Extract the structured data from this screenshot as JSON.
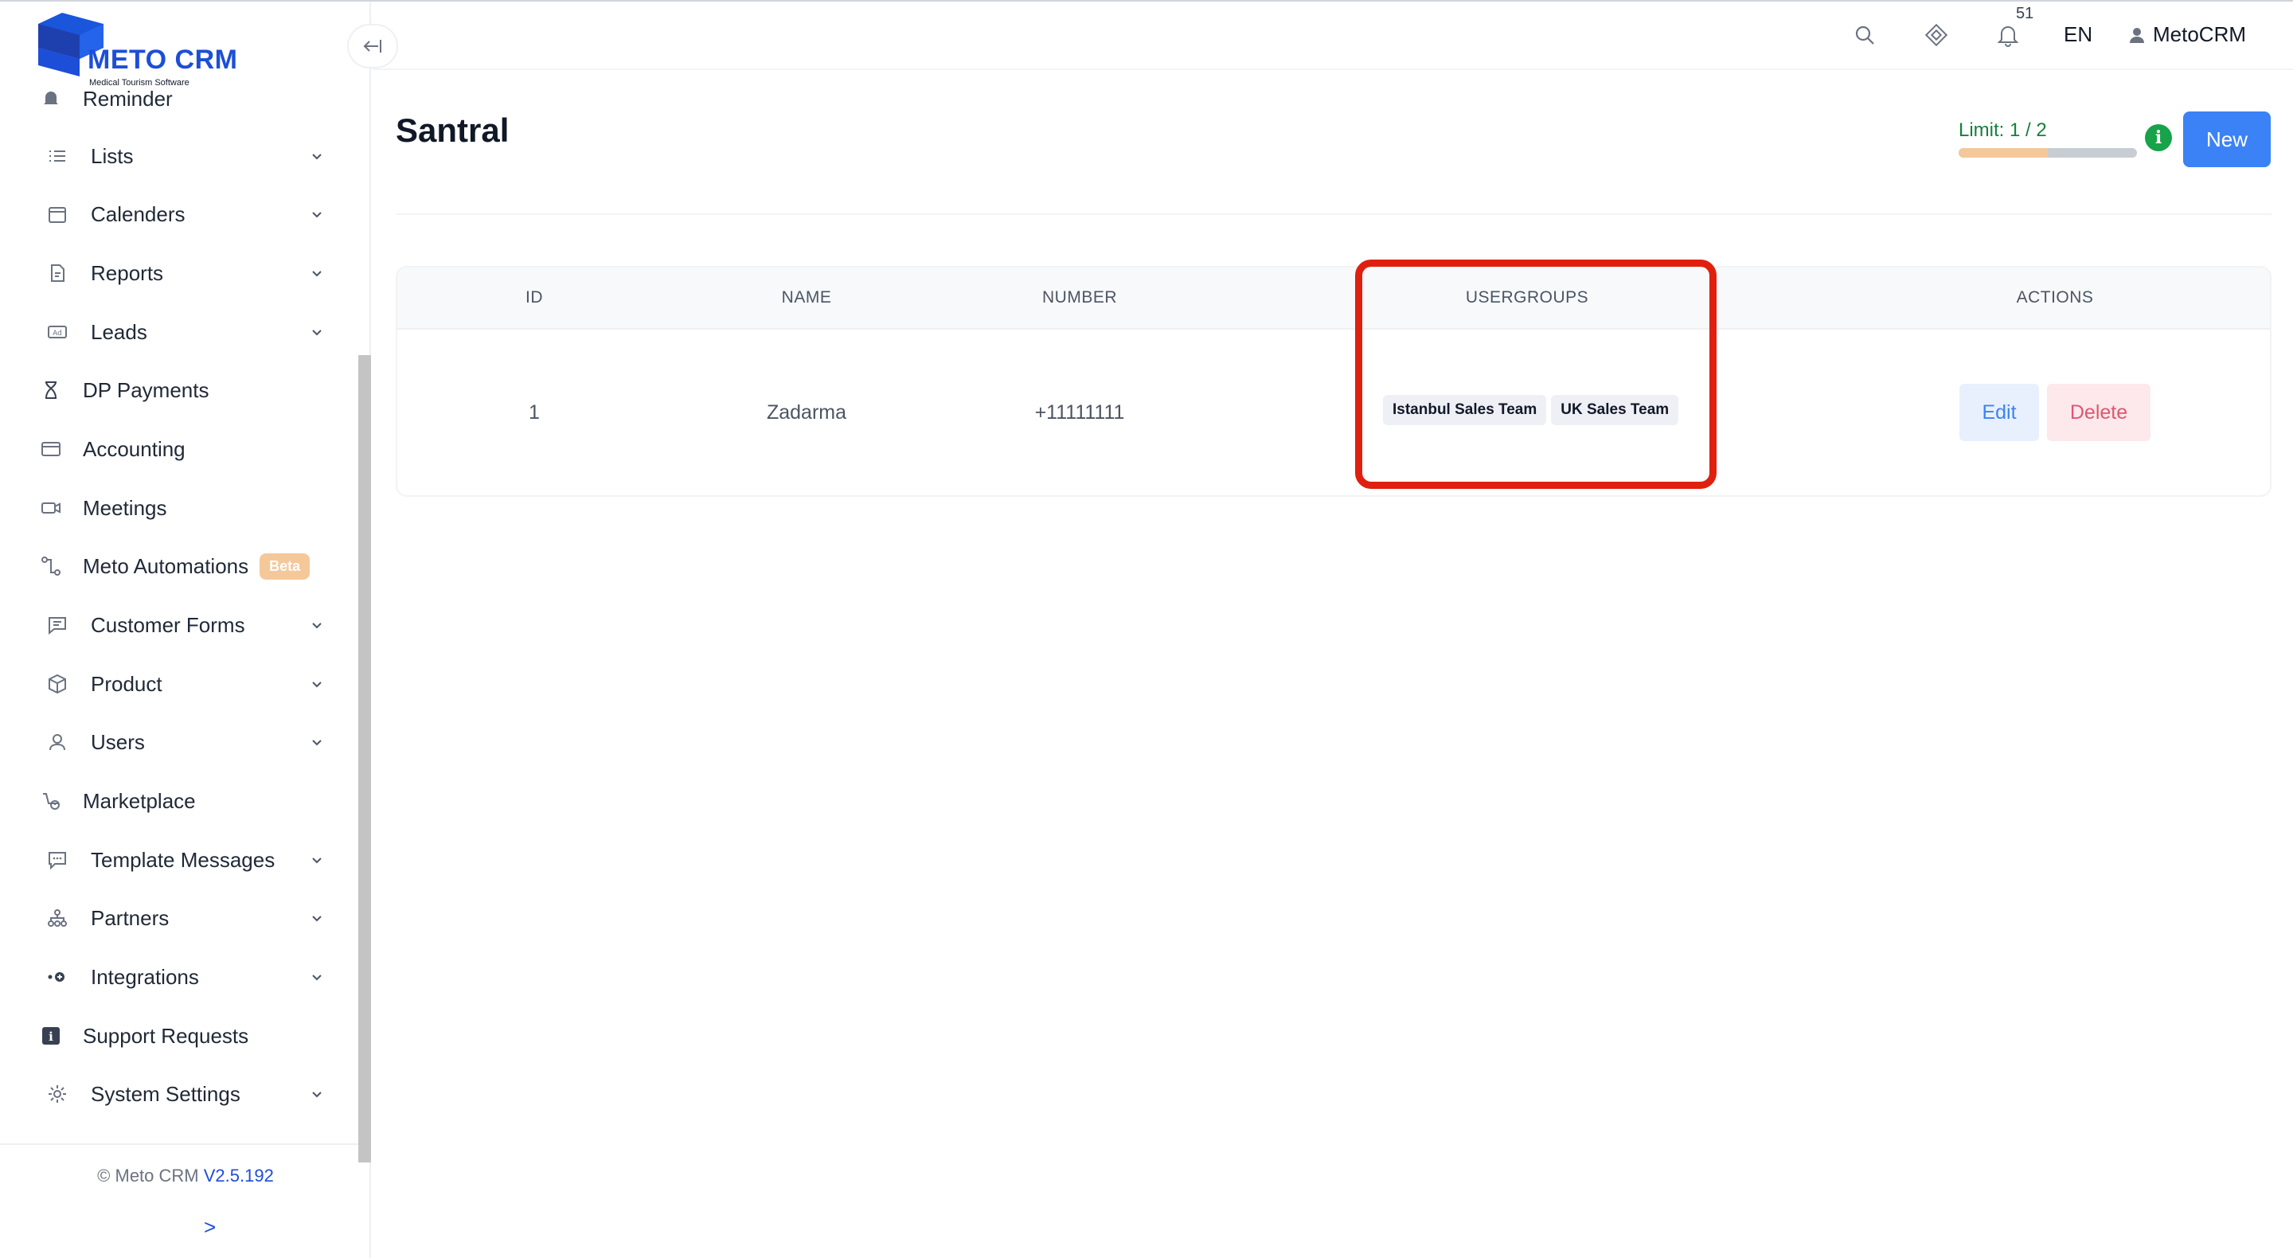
{
  "brand": {
    "name": "METO CRM",
    "tagline": "Medical Tourism Software",
    "color": "#1d4ed8"
  },
  "sidebar": {
    "items": [
      {
        "label": "Reminder",
        "icon": "bell-icon",
        "expandable": false
      },
      {
        "label": "Lists",
        "icon": "list-icon",
        "expandable": true
      },
      {
        "label": "Calenders",
        "icon": "calendar-icon",
        "expandable": true
      },
      {
        "label": "Reports",
        "icon": "report-icon",
        "expandable": true
      },
      {
        "label": "Leads",
        "icon": "ad-icon",
        "expandable": true
      },
      {
        "label": "DP Payments",
        "icon": "hourglass-icon",
        "expandable": false
      },
      {
        "label": "Accounting",
        "icon": "credit-card-icon",
        "expandable": false
      },
      {
        "label": "Meetings",
        "icon": "video-icon",
        "expandable": false
      },
      {
        "label": "Meto Automations",
        "icon": "automation-icon",
        "expandable": false,
        "badge": "Beta"
      },
      {
        "label": "Customer Forms",
        "icon": "form-icon",
        "expandable": true
      },
      {
        "label": "Product",
        "icon": "box-icon",
        "expandable": true
      },
      {
        "label": "Users",
        "icon": "user-icon",
        "expandable": true
      },
      {
        "label": "Marketplace",
        "icon": "marketplace-icon",
        "expandable": false
      },
      {
        "label": "Template Messages",
        "icon": "message-icon",
        "expandable": true
      },
      {
        "label": "Partners",
        "icon": "partners-icon",
        "expandable": true
      },
      {
        "label": "Integrations",
        "icon": "integration-icon",
        "expandable": true
      },
      {
        "label": "Support Requests",
        "icon": "info-square-icon",
        "expandable": false
      },
      {
        "label": "System Settings",
        "icon": "gear-icon",
        "expandable": true
      }
    ],
    "footer": {
      "copyright": "© Meto CRM",
      "version": "V2.5.192",
      "expand": ">"
    }
  },
  "header": {
    "notification_count": "51",
    "language": "EN",
    "user_name": "MetoCRM"
  },
  "page": {
    "title": "Santral",
    "limit_label": "Limit: 1 / 2",
    "limit_used": 1,
    "limit_total": 2,
    "new_button": "New"
  },
  "table": {
    "columns": [
      "ID",
      "NAME",
      "NUMBER",
      "USERGROUPS",
      "ACTIONS"
    ],
    "rows": [
      {
        "id": "1",
        "name": "Zadarma",
        "number": "+11111111",
        "usergroups": [
          "Istanbul Sales Team",
          "UK Sales Team"
        ],
        "actions": {
          "edit": "Edit",
          "delete": "Delete"
        }
      }
    ]
  },
  "colors": {
    "primary": "#3b82f6",
    "success": "#16a34a",
    "danger": "#e0566f",
    "highlight": "#e0200f"
  }
}
